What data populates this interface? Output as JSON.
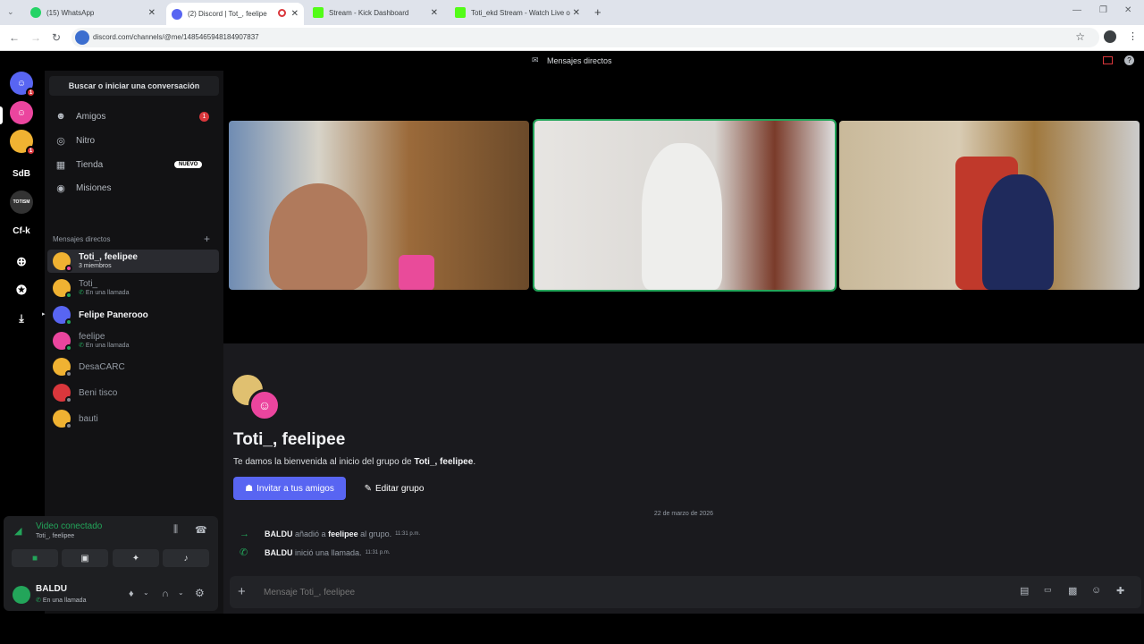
{
  "browser": {
    "tabs": [
      {
        "label": "(15) WhatsApp",
        "color": "#25d366"
      },
      {
        "label": "(2) Discord | Tot_, feelipe",
        "color": "#5865f2"
      },
      {
        "label": "Stream - Kick Dashboard",
        "color": "#53fc18"
      },
      {
        "label": "Toti_ekd Stream - Watch Live o",
        "color": "#53fc18"
      }
    ],
    "url": "discord.com/channels/@me/1485465948184907837"
  },
  "topbar": {
    "title": "Mensajes directos"
  },
  "guilds": [
    {
      "label": "",
      "badge": "1",
      "color": "#5865f2"
    },
    {
      "label": "",
      "badge": "",
      "color": "#eb459e"
    },
    {
      "label": "",
      "badge": "1",
      "color": "#f0b232"
    },
    {
      "label": "SdB",
      "badge": "",
      "color": "#000000"
    },
    {
      "label": "TOTISM",
      "badge": "",
      "color": "#333333"
    },
    {
      "label": "Cf-k",
      "badge": "",
      "color": "#000000"
    }
  ],
  "sidebar": {
    "search": "Buscar o iniciar una conversación",
    "nav": [
      {
        "label": "Amigos",
        "badge": "1"
      },
      {
        "label": "Nitro",
        "badge": ""
      },
      {
        "label": "Tienda",
        "badge": "NUEVO"
      },
      {
        "label": "Misiones",
        "badge": ""
      }
    ],
    "dm_header": "Mensajes directos",
    "dms": [
      {
        "name": "Toti_, feelipee",
        "sub": "3 miembros",
        "color": "#f0b232",
        "selected": true,
        "bright": true
      },
      {
        "name": "Toti_",
        "sub": "En una llamada",
        "color": "#f0b232",
        "bright": false
      },
      {
        "name": "Felipe Panerooo",
        "sub": "",
        "color": "#5865f2",
        "bright": true
      },
      {
        "name": "feelipe",
        "sub": "En una llamada",
        "color": "#eb459e",
        "bright": false
      },
      {
        "name": "DesaCARC",
        "sub": "",
        "color": "#f0b232",
        "bright": false
      },
      {
        "name": "Beni tisco",
        "sub": "",
        "color": "#da373c",
        "bright": false
      },
      {
        "name": "bauti",
        "sub": "",
        "color": "#f0b232",
        "bright": false
      }
    ]
  },
  "voice": {
    "status": "Video conectado",
    "channel": "Toti_, feelipee"
  },
  "user": {
    "name": "BALDU",
    "status": "En una llamada"
  },
  "main": {
    "group_name": "Toti_, feelipee",
    "welcome_prefix": "Te damos la bienvenida al inicio del grupo de ",
    "welcome_group": "Toti_, feelipee",
    "welcome_suffix": ".",
    "invite_label": "Invitar a tus amigos",
    "edit_label": "Editar grupo",
    "date": "22 de marzo de 2026",
    "messages": [
      {
        "actor": "BALDU",
        "verb": "añadió a",
        "target": "feelipee",
        "rest": "al grupo.",
        "time": "11:31 p.m."
      },
      {
        "actor": "BALDU",
        "verb": "inició una llamada.",
        "target": "",
        "rest": "",
        "time": "11:31 p.m."
      }
    ],
    "composer_placeholder": "Mensaje Toti_, feelipee"
  },
  "colors": {
    "accent": "#5865f2",
    "online": "#23a55a",
    "danger": "#da373c"
  }
}
